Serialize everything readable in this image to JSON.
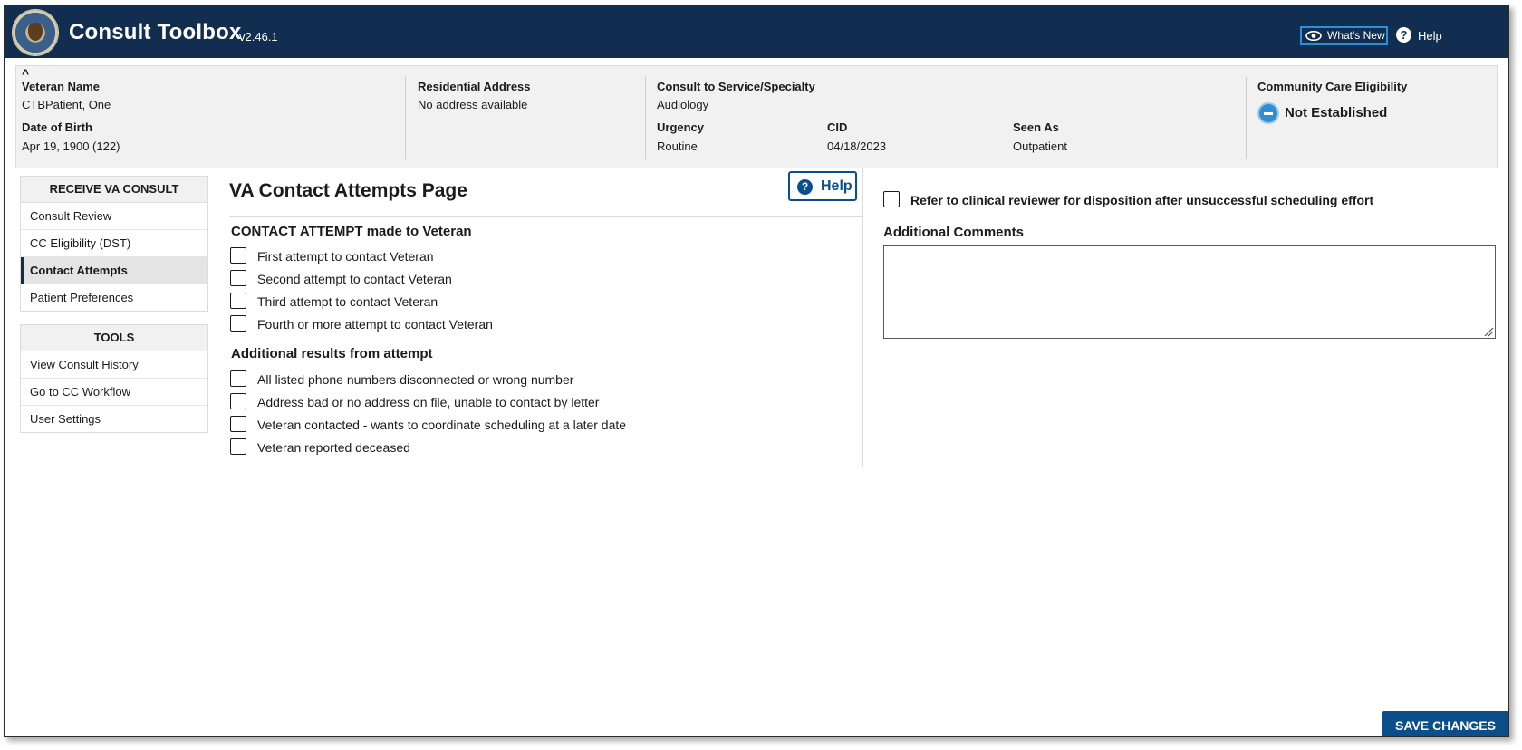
{
  "header": {
    "app_title": "Consult Toolbox",
    "version": "v2.46.1",
    "whats_new_label": "What's New",
    "help_label": "Help"
  },
  "patient": {
    "veteran_name_label": "Veteran Name",
    "veteran_name": "CTBPatient, One",
    "dob_label": "Date of Birth",
    "dob": "Apr 19, 1900 (122)",
    "address_label": "Residential Address",
    "address": "No address available",
    "consult_label": "Consult to Service/Specialty",
    "consult": "Audiology",
    "urgency_label": "Urgency",
    "urgency": "Routine",
    "cid_label": "CID",
    "cid": "04/18/2023",
    "seen_as_label": "Seen As",
    "seen_as": "Outpatient",
    "cc_eligibility_label": "Community Care Eligibility",
    "cc_eligibility": "Not Established"
  },
  "sidebar": {
    "receive_head": "RECEIVE VA CONSULT",
    "receive_items": [
      {
        "label": "Consult Review"
      },
      {
        "label": "CC Eligibility (DST)"
      },
      {
        "label": "Contact Attempts",
        "active": true
      },
      {
        "label": "Patient Preferences"
      }
    ],
    "tools_head": "TOOLS",
    "tools_items": [
      {
        "label": "View Consult History"
      },
      {
        "label": "Go to CC Workflow"
      },
      {
        "label": "User Settings"
      }
    ]
  },
  "main": {
    "page_title": "VA Contact Attempts Page",
    "help_button": "Help",
    "contact_section": "CONTACT ATTEMPT made to Veteran",
    "contact_options": [
      "First attempt to contact Veteran",
      "Second attempt to contact Veteran",
      "Third attempt to contact Veteran",
      "Fourth or more attempt to contact Veteran"
    ],
    "results_section": "Additional results from attempt",
    "results_options": [
      "All listed phone numbers disconnected or wrong number",
      "Address bad or no address on file, unable to contact by letter",
      "Veteran contacted - wants to coordinate scheduling at a later date",
      "Veteran reported deceased"
    ],
    "refer_label": "Refer to clinical reviewer for disposition after unsuccessful scheduling effort",
    "comments_label": "Additional Comments",
    "comments_value": ""
  },
  "footer": {
    "save_label": "SAVE CHANGES"
  },
  "colors": {
    "header_bg": "#112e51",
    "accent": "#0b4f8a",
    "banner_bg": "#f1f1f1"
  }
}
